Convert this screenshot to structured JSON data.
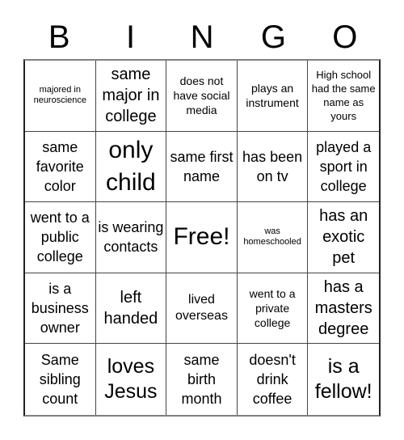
{
  "header": {
    "letters": [
      "B",
      "I",
      "N",
      "G",
      "O"
    ]
  },
  "cells": [
    {
      "text": "majored in neuroscience"
    },
    {
      "text": "same major in college"
    },
    {
      "text": "does not have social media"
    },
    {
      "text": "plays an instrument"
    },
    {
      "text": "High school had the same name as yours"
    },
    {
      "text": "same favorite color"
    },
    {
      "text": "only child"
    },
    {
      "text": "same first name"
    },
    {
      "text": "has been on tv"
    },
    {
      "text": "played a sport in college"
    },
    {
      "text": "went to a public college"
    },
    {
      "text": "is wearing contacts"
    },
    {
      "text": "Free!"
    },
    {
      "text": "was homeschooled"
    },
    {
      "text": "has an exotic pet"
    },
    {
      "text": "is a business owner"
    },
    {
      "text": "left handed"
    },
    {
      "text": "lived overseas"
    },
    {
      "text": "went to a private college"
    },
    {
      "text": "has a masters degree"
    },
    {
      "text": "Same sibling count"
    },
    {
      "text": "loves Jesus"
    },
    {
      "text": "same birth month"
    },
    {
      "text": "doesn't drink coffee"
    },
    {
      "text": "is a fellow!"
    }
  ]
}
